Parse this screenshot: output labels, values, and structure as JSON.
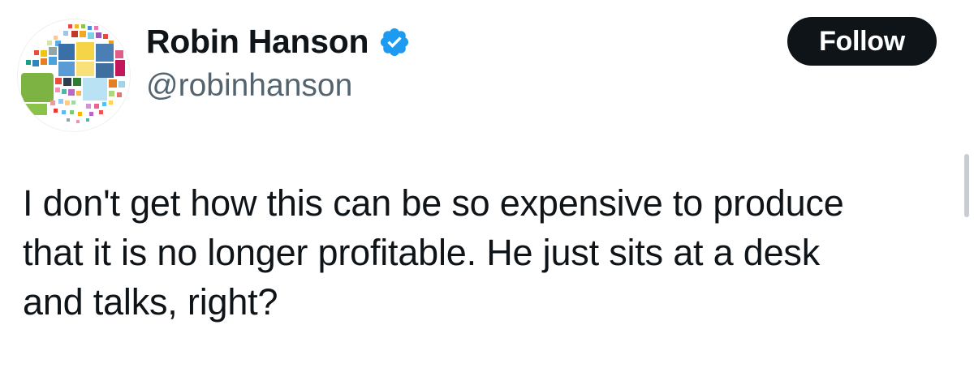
{
  "author": {
    "display_name": "Robin Hanson",
    "handle": "@robinhanson",
    "verified": true
  },
  "follow_button": {
    "label": "Follow"
  },
  "tweet": {
    "text": "I don't get how this can be so expensive to produce\nthat it is no longer profitable. He just sits at a desk\nand talks, right?"
  },
  "icons": {
    "verified": "verified-badge-icon",
    "avatar": "avatar-mosaic"
  },
  "colors": {
    "verified_blue": "#1d9bf0",
    "follow_bg": "#0f1419",
    "handle_gray": "#536471"
  }
}
